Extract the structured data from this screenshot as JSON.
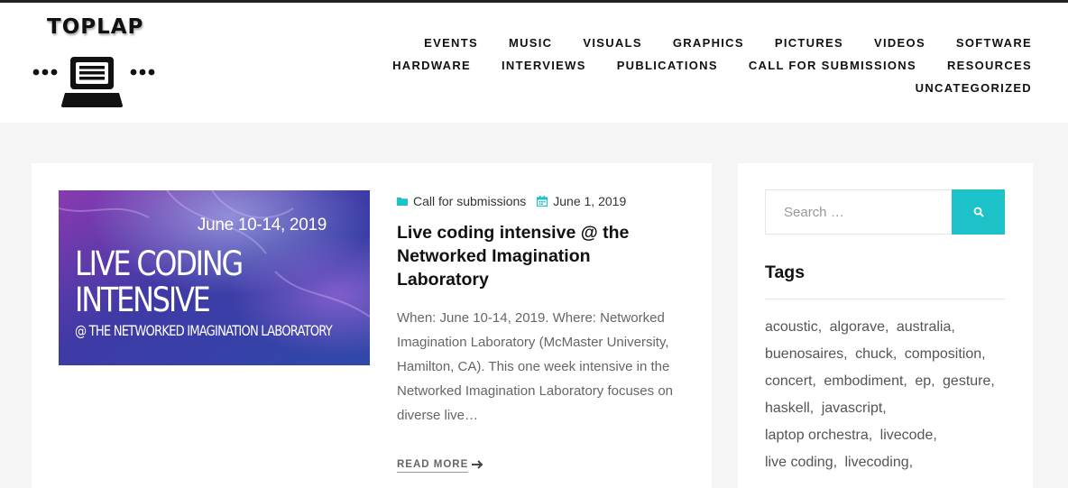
{
  "site": {
    "logo_text": "TOPLAP"
  },
  "nav": {
    "row1": [
      "EVENTS",
      "MUSIC",
      "VISUALS",
      "GRAPHICS",
      "PICTURES",
      "VIDEOS",
      "SOFTWARE"
    ],
    "row2": [
      "HARDWARE",
      "INTERVIEWS",
      "PUBLICATIONS",
      "CALL FOR SUBMISSIONS",
      "RESOURCES"
    ],
    "row3": [
      "UNCATEGORIZED"
    ]
  },
  "post": {
    "thumbnail": {
      "date_text": "June 10-14, 2019",
      "title_line1": "LIVE CODING",
      "title_line2": "INTENSIVE",
      "subtitle": "@ THE NETWORKED IMAGINATION LABORATORY"
    },
    "category": "Call for submissions",
    "date": "June 1, 2019",
    "title": "Live coding intensive @ the Networked Imagination Laboratory",
    "excerpt": "When: June 10-14, 2019. Where: Networked Imagination Laboratory (McMaster University, Hamilton, CA). This one week intensive in the Networked Imagination Laboratory focuses on diverse live…",
    "read_more": "READ MORE"
  },
  "sidebar": {
    "search_placeholder": "Search …",
    "tags_title": "Tags",
    "tags": [
      "acoustic,",
      "algorave,",
      "australia,",
      "buenosaires,",
      "chuck,",
      "composition,",
      "concert,",
      "embodiment,",
      "ep,",
      "gesture,",
      "haskell,",
      "javascript,",
      "laptop orchestra,",
      "livecode,",
      "live coding,",
      "livecoding,"
    ]
  },
  "colors": {
    "accent": "#1cc2c8",
    "thumbnail_bg": "#3a3ea6"
  }
}
